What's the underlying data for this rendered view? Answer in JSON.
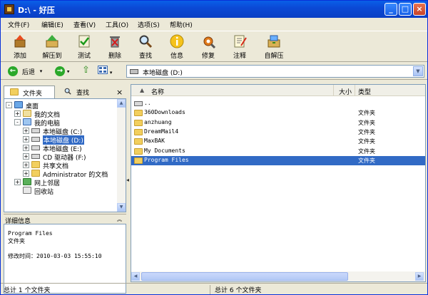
{
  "window": {
    "title": "D:\\ - 好压"
  },
  "menu": [
    "文件(F)",
    "编辑(E)",
    "查看(V)",
    "工具(O)",
    "选项(S)",
    "帮助(H)"
  ],
  "toolbar": [
    {
      "label": "添加",
      "icon": "add-icon"
    },
    {
      "label": "解压到",
      "icon": "extract-to-icon"
    },
    {
      "label": "测试",
      "icon": "test-icon"
    },
    {
      "label": "删除",
      "icon": "delete-icon"
    },
    {
      "label": "查找",
      "icon": "find-icon"
    },
    {
      "label": "信息",
      "icon": "info-icon"
    },
    {
      "label": "修复",
      "icon": "repair-icon"
    },
    {
      "label": "注释",
      "icon": "comment-icon"
    },
    {
      "label": "自解压",
      "icon": "sfx-icon"
    }
  ],
  "nav": {
    "back_label": "后退",
    "address": "本地磁盘 (D:)"
  },
  "tabs": {
    "folders": "文件夹",
    "search": "查找",
    "close": "×"
  },
  "tree": [
    {
      "label": "桌面",
      "level": 0,
      "exp": "-",
      "icon": "desktop"
    },
    {
      "label": "我的文档",
      "level": 1,
      "exp": "+",
      "icon": "docs"
    },
    {
      "label": "我的电脑",
      "level": 1,
      "exp": "-",
      "icon": "computer"
    },
    {
      "label": "本地磁盘 (C:)",
      "level": 2,
      "exp": "+",
      "icon": "drive"
    },
    {
      "label": "本地磁盘 (D:)",
      "level": 2,
      "exp": "+",
      "icon": "drive",
      "selected": true
    },
    {
      "label": "本地磁盘 (E:)",
      "level": 2,
      "exp": "+",
      "icon": "drive"
    },
    {
      "label": "CD 驱动器 (F:)",
      "level": 2,
      "exp": "+",
      "icon": "cd"
    },
    {
      "label": "共享文档",
      "level": 2,
      "exp": "+",
      "icon": "folder"
    },
    {
      "label": "Administrator 的文档",
      "level": 2,
      "exp": "+",
      "icon": "folder"
    },
    {
      "label": "网上邻居",
      "level": 1,
      "exp": "+",
      "icon": "network"
    },
    {
      "label": "回收站",
      "level": 1,
      "exp": "",
      "icon": "recycle"
    }
  ],
  "detail": {
    "header": "详细信息",
    "collapse": "︽",
    "name": "Program Files",
    "type": "文件夹",
    "modified": "修改时间：2010-03-03 15:55:10"
  },
  "columns": {
    "name": "名称",
    "size": "大小",
    "type": "类型"
  },
  "files": [
    {
      "name": "..",
      "type": "",
      "icon": "up"
    },
    {
      "name": "360Downloads",
      "type": "文件夹",
      "icon": "folder"
    },
    {
      "name": "anzhuang",
      "type": "文件夹",
      "icon": "folder"
    },
    {
      "name": "DreamMail4",
      "type": "文件夹",
      "icon": "folder"
    },
    {
      "name": "MaxBAK",
      "type": "文件夹",
      "icon": "folder"
    },
    {
      "name": "My Documents",
      "type": "文件夹",
      "icon": "folder"
    },
    {
      "name": "Program Files",
      "type": "文件夹",
      "icon": "folder",
      "selected": true
    }
  ],
  "status": {
    "left": "总计 1 个文件夹",
    "right": "总计 6 个文件夹"
  }
}
